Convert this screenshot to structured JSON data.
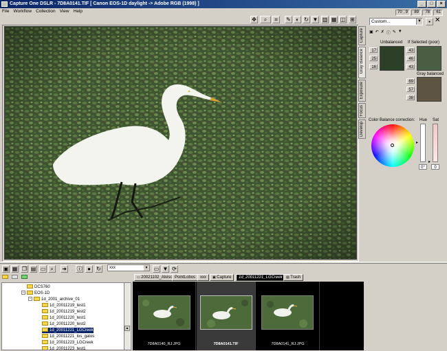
{
  "window": {
    "title": "Capture One DSLR - 7D8A0141.TIF [ Canon EOS-1D daylight -> Adobe RGB (1998) ]",
    "buttons": [
      "_",
      "□",
      "×"
    ]
  },
  "menu": [
    "File",
    "Workflow",
    "Collection",
    "View",
    "Help"
  ],
  "cursor_readout": {
    "xy": "70 , 9",
    "r": "89",
    "g": "78",
    "b": "61"
  },
  "panel": {
    "preset": "Custom...",
    "unbalanced_label": "Unbalanced",
    "if_selected_label": "If Selected (poor)",
    "gray_balanced_label": "Gray balanced",
    "unbalanced_rgb": [
      "17",
      "25",
      "16"
    ],
    "selected_rgb": [
      "43",
      "46",
      "43"
    ],
    "gray_rgb": [
      "69",
      "57",
      "38"
    ],
    "color_balance_label": "Color Balance correction:",
    "hue_label": "Hue",
    "sat_label": "Sat",
    "hue_value": "0°",
    "sat_value": "0"
  },
  "side_tabs": [
    "Capture",
    "Gray Balance",
    "Exposure",
    "Focus",
    "Develop"
  ],
  "folder_combo": "xxx",
  "folder_tree": [
    "DCS760",
    "EOS-1D",
    "1d_2001_archive_01",
    "1d_20011219_test1",
    "1d_20011219_test2",
    "1d_20011220_test1",
    "1d_20011220_test2",
    "1d_20011221_LGCreek",
    "1d_20011221_los_gatos",
    "1d_20011223_LGCreek",
    "1d_20011223_test1"
  ],
  "tabs": [
    "20021102_Alviso",
    "PointLobos",
    "xxx",
    "Capture",
    "1d_20011221_LGCreek",
    "Trash"
  ],
  "thumbnails": [
    {
      "filename": "7D8A0140_RJ.JPG",
      "selected": false
    },
    {
      "filename": "7D8A0141.TIF",
      "selected": true
    },
    {
      "filename": "7D8A0141_RJ.JPG",
      "selected": false
    }
  ],
  "colors": {
    "title_bar": "#0a246a",
    "face": "#d4d0c8",
    "browser_bg": "#000000"
  }
}
